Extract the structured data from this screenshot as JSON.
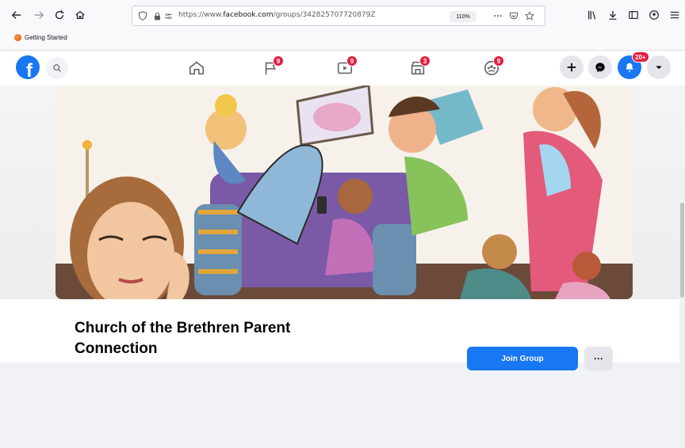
{
  "browser": {
    "url_prefix": "https://www.",
    "url_domain": "facebook.com",
    "url_path": "/groups/342825707720879Z",
    "zoom": "110%",
    "bookmark_label": "Getting Started"
  },
  "fb": {
    "logo": "f",
    "badges": {
      "pages": "9",
      "watch": "9",
      "marketplace": "3",
      "groups": "9",
      "notifications": "20+"
    }
  },
  "group": {
    "title": "Church of the Brethren Parent Connection",
    "join_label": "Join Group",
    "more_label": "···"
  },
  "icons": [
    "back-icon",
    "forward-icon",
    "reload-icon",
    "home-icon",
    "shield-icon",
    "lock-icon",
    "permissions-icon",
    "more-actions-icon",
    "pocket-icon",
    "star-icon",
    "library-icon",
    "download-icon",
    "sidebar-icon",
    "account-icon",
    "menu-icon",
    "search-icon",
    "fb-home-icon",
    "flag-icon",
    "watch-icon",
    "marketplace-icon",
    "groups-icon",
    "plus-icon",
    "messenger-icon",
    "bell-icon",
    "caret-down-icon"
  ],
  "colors": {
    "fb_blue": "#1877f2",
    "badge_red": "#e41e3f"
  }
}
